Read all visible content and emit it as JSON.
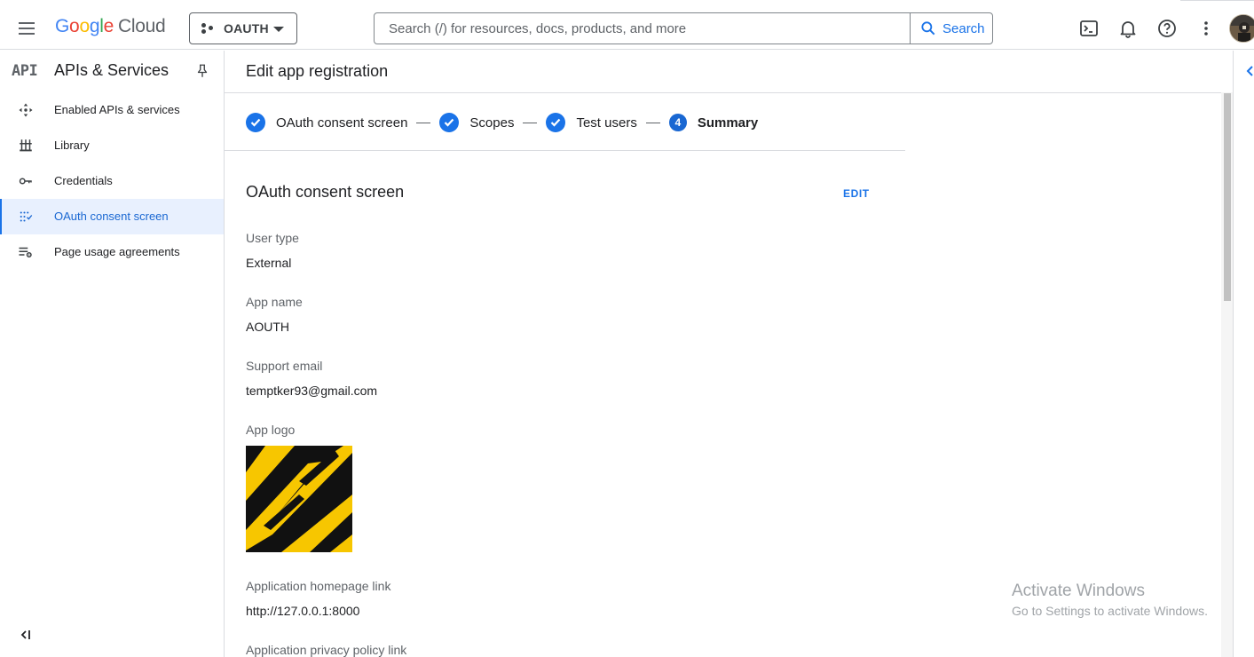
{
  "header": {
    "logo": {
      "g1": "G",
      "g2": "o",
      "g3": "o",
      "g4": "g",
      "g5": "l",
      "g6": "e",
      "cloud": "Cloud"
    },
    "project_label": "OAUTH",
    "search_placeholder": "Search (/) for resources, docs, products, and more",
    "search_button": "Search",
    "icons": [
      "menu-icon",
      "cloud-shell-icon",
      "notifications-icon",
      "help-icon",
      "more-vert-icon",
      "avatar"
    ]
  },
  "sidebar": {
    "badge": "API",
    "title": "APIs & Services",
    "items": [
      {
        "label": "Enabled APIs & services",
        "icon": "enabled-apis-icon"
      },
      {
        "label": "Library",
        "icon": "library-icon"
      },
      {
        "label": "Credentials",
        "icon": "key-icon"
      },
      {
        "label": "OAuth consent screen",
        "icon": "consent-icon",
        "active": true
      },
      {
        "label": "Page usage agreements",
        "icon": "settings-list-icon"
      }
    ]
  },
  "main": {
    "title": "Edit app registration",
    "steps": [
      {
        "label": "OAuth consent screen",
        "state": "done"
      },
      {
        "label": "Scopes",
        "state": "done"
      },
      {
        "label": "Test users",
        "state": "done"
      },
      {
        "label": "Summary",
        "state": "current",
        "number": "4"
      }
    ],
    "section_title": "OAuth consent screen",
    "edit_label": "EDIT",
    "fields": {
      "user_type": {
        "label": "User type",
        "value": "External"
      },
      "app_name": {
        "label": "App name",
        "value": "AOUTH"
      },
      "support_email": {
        "label": "Support email",
        "value": "temptker93@gmail.com"
      },
      "app_logo": {
        "label": "App logo"
      },
      "homepage": {
        "label": "Application homepage link",
        "value": "http://127.0.0.1:8000"
      },
      "privacy": {
        "label": "Application privacy policy link"
      }
    }
  },
  "watermark": {
    "line1": "Activate Windows",
    "line2": "Go to Settings to activate Windows."
  },
  "colors": {
    "accent": "#1a73e8",
    "active_bg": "#e8f0fe",
    "logo_yellow": "#f7c600",
    "logo_black": "#111111"
  }
}
